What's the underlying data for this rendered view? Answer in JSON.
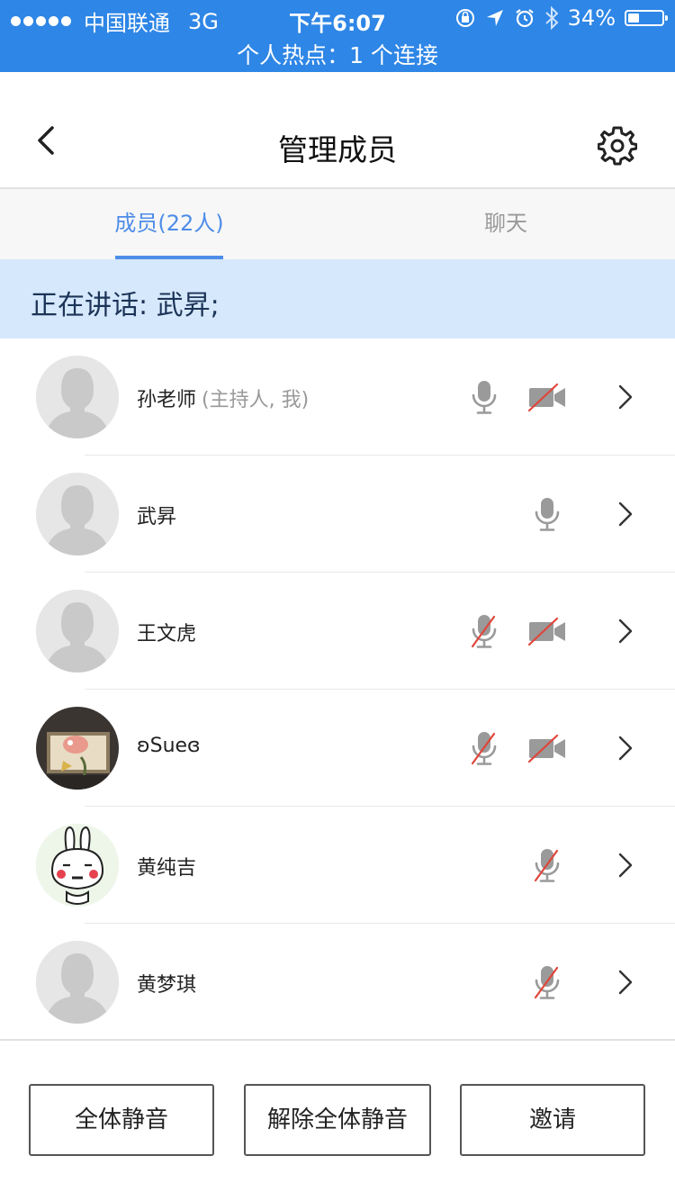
{
  "status_bar": {
    "carrier": "中国联通",
    "network": "3G",
    "time": "下午6:07",
    "battery": "34%",
    "battery_level": 0.34,
    "hotspot": "个人热点：1 个连接",
    "icons": [
      "signal-dots",
      "rotation-lock-icon",
      "location-icon",
      "alarm-icon",
      "bluetooth-icon",
      "battery-icon"
    ]
  },
  "header": {
    "title": "管理成员",
    "back_icon": "chevron-left-icon",
    "settings_icon": "gear-icon"
  },
  "tabs": [
    {
      "label": "成员(22人)",
      "active": true
    },
    {
      "label": "聊天",
      "active": false
    }
  ],
  "speaking": {
    "text": "正在讲话: 武昇;"
  },
  "members": [
    {
      "name": "孙老师",
      "role": "(主持人, 我)",
      "avatar": "default",
      "mic": "on",
      "video": "off"
    },
    {
      "name": "武昇",
      "role": "",
      "avatar": "default",
      "mic": "on",
      "video": "none"
    },
    {
      "name": "王文虎",
      "role": "",
      "avatar": "default",
      "mic": "off",
      "video": "off"
    },
    {
      "name": "ʚSueɞ",
      "role": "",
      "avatar": "photo",
      "mic": "off",
      "video": "off"
    },
    {
      "name": "黄纯吉",
      "role": "",
      "avatar": "rabbit",
      "mic": "off",
      "video": "none"
    },
    {
      "name": "黄梦琪",
      "role": "",
      "avatar": "default",
      "mic": "off",
      "video": "none"
    }
  ],
  "footer": {
    "mute_all": "全体静音",
    "unmute_all": "解除全体静音",
    "invite": "邀请"
  },
  "colors": {
    "status_bar": "#2e86e6",
    "accent": "#4e8de8",
    "speaking_bg": "#d6e8fc",
    "muted_slash": "#e0453a",
    "icon_gray": "#9a9a9a"
  }
}
